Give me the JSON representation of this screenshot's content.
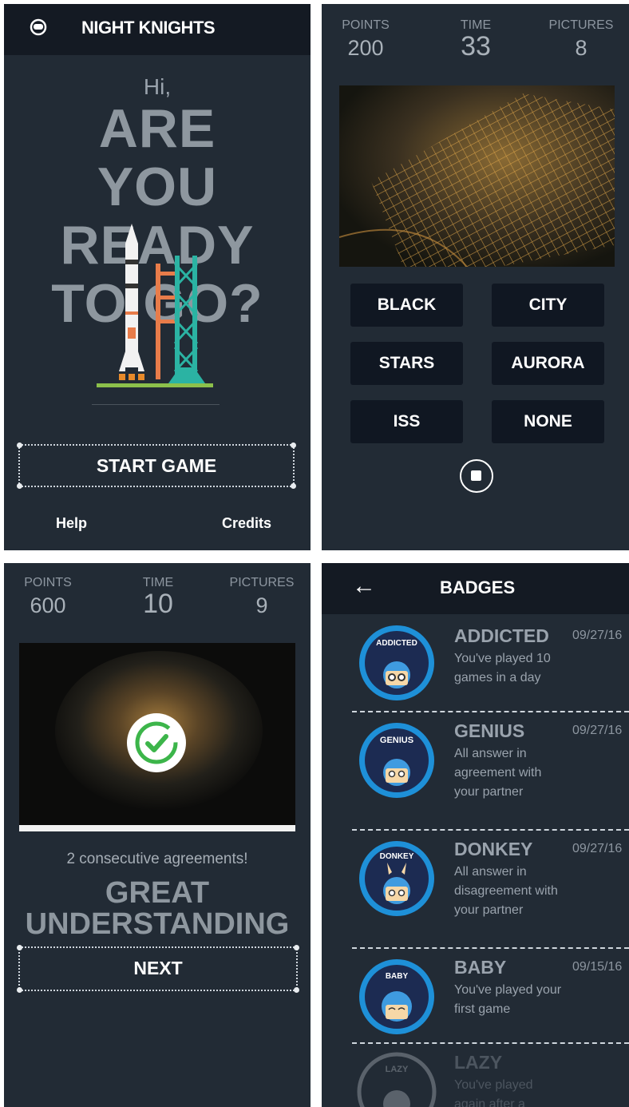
{
  "screen1": {
    "app_title": "NIGHT KNIGHTS",
    "greeting": "Hi,",
    "headline": [
      "ARE",
      "YOU",
      "READY",
      "TO GO?"
    ],
    "start_label": "START GAME",
    "help_label": "Help",
    "credits_label": "Credits"
  },
  "screen2": {
    "points_label": "POINTS",
    "points": "200",
    "time_label": "TIME",
    "time": "33",
    "pictures_label": "PICTURES",
    "pictures": "8",
    "choices": [
      "BLACK",
      "CITY",
      "STARS",
      "AURORA",
      "ISS",
      "NONE"
    ]
  },
  "screen3": {
    "points_label": "POINTS",
    "points": "600",
    "time_label": "TIME",
    "time": "10",
    "pictures_label": "PICTURES",
    "pictures": "9",
    "message": "2 consecutive agreements!",
    "headline": [
      "GREAT",
      "UNDERSTANDING"
    ],
    "next_label": "NEXT"
  },
  "screen4": {
    "title": "BADGES",
    "badges": [
      {
        "name": "ADDICTED",
        "date": "09/27/16",
        "desc": "You've played 10 games in a day",
        "ring_text": "ADDICTED"
      },
      {
        "name": "GENIUS",
        "date": "09/27/16",
        "desc": "All answer in agreement with your partner",
        "ring_text": "GENIUS"
      },
      {
        "name": "DONKEY",
        "date": "09/27/16",
        "desc": "All answer in disagreement with your partner",
        "ring_text": "DONKEY"
      },
      {
        "name": "BABY",
        "date": "09/15/16",
        "desc": "You've played your first game",
        "ring_text": "BABY"
      },
      {
        "name": "LAZY",
        "date": "",
        "desc": "You've played again after a",
        "ring_text": "LAZY"
      }
    ]
  },
  "colors": {
    "panel_bg": "#222b35",
    "topbar_bg": "#141a23",
    "button_bg": "#101722",
    "badge_ring": "#1e90d8",
    "check_green": "#3cb54a"
  },
  "icons": [
    "astronaut-helmet-icon",
    "rocket-illustration",
    "stop-icon",
    "check-icon",
    "back-arrow-icon"
  ]
}
